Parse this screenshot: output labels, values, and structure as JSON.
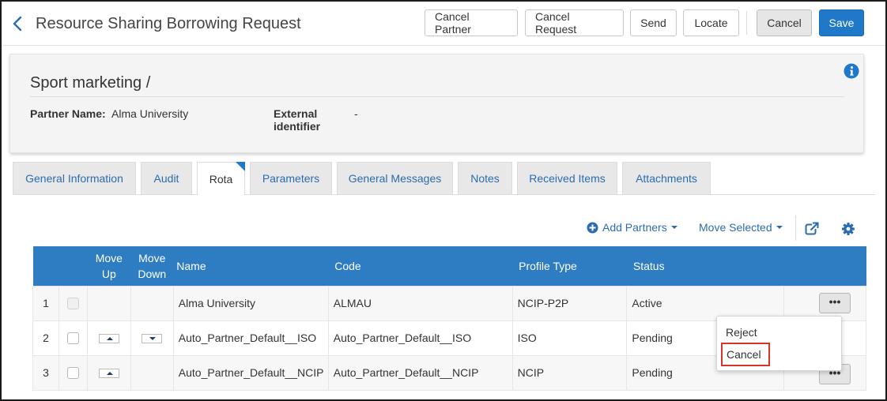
{
  "header": {
    "title": "Resource Sharing Borrowing Request",
    "buttons": {
      "cancel_partner": "Cancel Partner",
      "cancel_request": "Cancel Request",
      "send": "Send",
      "locate": "Locate",
      "cancel": "Cancel",
      "save": "Save"
    }
  },
  "summary": {
    "title": "Sport marketing /",
    "partner_label": "Partner Name:",
    "partner_value": "Alma University",
    "external_label_1": "External",
    "external_label_2": "identifier",
    "external_value": "-"
  },
  "tabs": [
    "General Information",
    "Audit",
    "Rota",
    "Parameters",
    "General Messages",
    "Notes",
    "Received Items",
    "Attachments"
  ],
  "active_tab": "Rota",
  "toolbar": {
    "add_partners": "Add Partners",
    "move_selected": "Move Selected"
  },
  "table": {
    "columns": {
      "move_up_1": "Move",
      "move_up_2": "Up",
      "move_down_1": "Move",
      "move_down_2": "Down",
      "name": "Name",
      "code": "Code",
      "profile_type": "Profile Type",
      "status": "Status"
    },
    "rows": [
      {
        "num": "1",
        "name": "Alma University",
        "code": "ALMAU",
        "profile_type": "NCIP-P2P",
        "status": "Active"
      },
      {
        "num": "2",
        "name": "Auto_Partner_Default__ISO",
        "code": "Auto_Partner_Default__ISO",
        "profile_type": "ISO",
        "status": "Pending"
      },
      {
        "num": "3",
        "name": "Auto_Partner_Default__NCIP",
        "code": "Auto_Partner_Default__NCIP",
        "profile_type": "NCIP",
        "status": "Pending"
      }
    ],
    "row_actions_label": "•••"
  },
  "row_menu": {
    "reject": "Reject",
    "cancel": "Cancel"
  },
  "colors": {
    "primary": "#1f78c8",
    "table_header": "#2e7cc2",
    "link": "#2b6cb0",
    "highlight_border": "#d9342b"
  }
}
